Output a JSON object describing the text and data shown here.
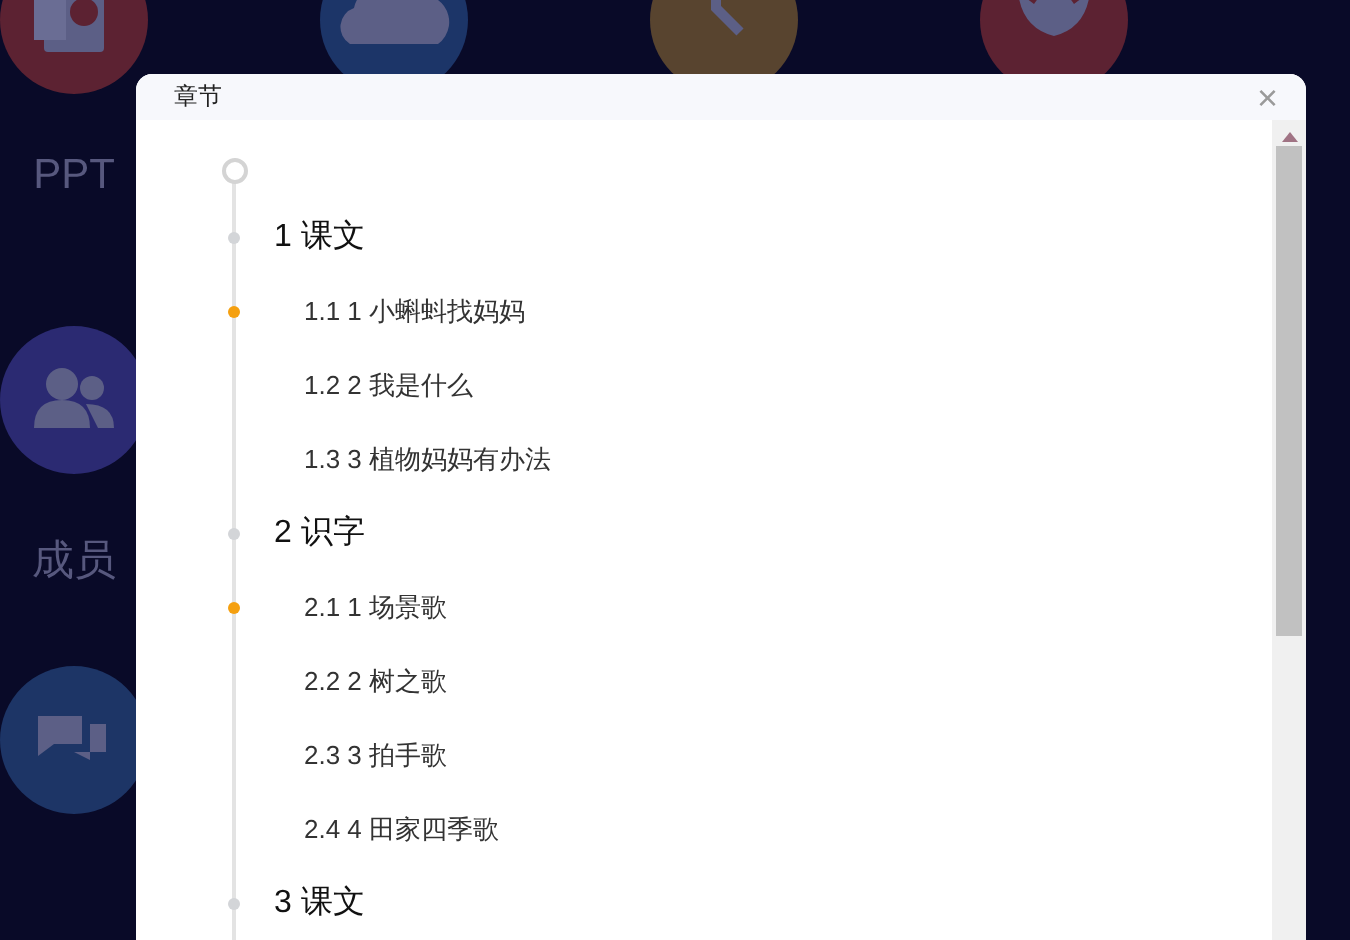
{
  "apps": [
    {
      "kind": "ppt",
      "color": "#5c2232",
      "label": "PPT"
    },
    {
      "kind": "cloud",
      "color": "#1c3568"
    },
    {
      "kind": "clock",
      "color": "#58442f"
    },
    {
      "kind": "lotus",
      "color": "#5c2232"
    },
    {
      "kind": "members",
      "color": "#2b2a72",
      "label": "成员"
    },
    {
      "kind": "chat",
      "color": "#1d3566"
    }
  ],
  "dialog": {
    "title": "章节",
    "close": "×"
  },
  "chapters": [
    {
      "label": "1 课文",
      "children": [
        {
          "label": "1.1 1 小蝌蚪找妈妈",
          "selected": true
        },
        {
          "label": "1.2 2 我是什么",
          "selected": false
        },
        {
          "label": "1.3 3 植物妈妈有办法",
          "selected": false
        }
      ]
    },
    {
      "label": "2 识字",
      "children": [
        {
          "label": "2.1 1 场景歌",
          "selected": true
        },
        {
          "label": "2.2 2 树之歌",
          "selected": false
        },
        {
          "label": "2.3 3 拍手歌",
          "selected": false
        },
        {
          "label": "2.4 4 田家四季歌",
          "selected": false
        }
      ]
    },
    {
      "label": "3 课文"
    }
  ]
}
